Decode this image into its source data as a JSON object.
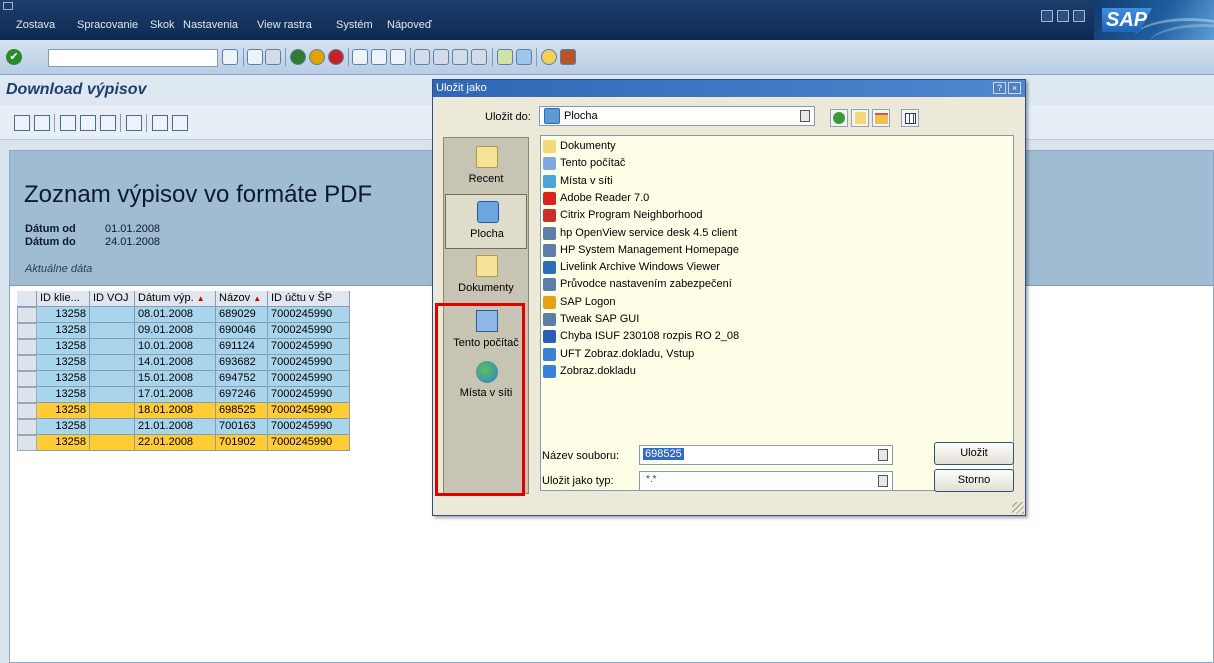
{
  "window": {
    "menu": [
      "Zostava",
      "Spracovanie",
      "Skok",
      "Nastavenia",
      "View rastra",
      "Systém",
      "Nápoveď"
    ],
    "logo_text": "SAP"
  },
  "screen": {
    "title": "Download výpisov"
  },
  "report": {
    "title": "Zoznam výpisov vo formáte PDF",
    "date_from_label": "Dátum od",
    "date_from": "01.01.2008",
    "date_to_label": "Dátum do",
    "date_to": "24.01.2008",
    "note": "Aktuálne dáta"
  },
  "grid": {
    "columns": [
      "ID klie...",
      "ID VOJ",
      "Dátum výp.",
      "Názov",
      "ID účtu v ŠP"
    ],
    "rows": [
      {
        "id": "13258",
        "voj": "",
        "date": "08.01.2008",
        "name": "689029",
        "account": "7000245990",
        "highlight": false
      },
      {
        "id": "13258",
        "voj": "",
        "date": "09.01.2008",
        "name": "690046",
        "account": "7000245990",
        "highlight": false
      },
      {
        "id": "13258",
        "voj": "",
        "date": "10.01.2008",
        "name": "691124",
        "account": "7000245990",
        "highlight": false
      },
      {
        "id": "13258",
        "voj": "",
        "date": "14.01.2008",
        "name": "693682",
        "account": "7000245990",
        "highlight": false
      },
      {
        "id": "13258",
        "voj": "",
        "date": "15.01.2008",
        "name": "694752",
        "account": "7000245990",
        "highlight": false
      },
      {
        "id": "13258",
        "voj": "",
        "date": "17.01.2008",
        "name": "697246",
        "account": "7000245990",
        "highlight": false
      },
      {
        "id": "13258",
        "voj": "",
        "date": "18.01.2008",
        "name": "698525",
        "account": "7000245990",
        "highlight": true
      },
      {
        "id": "13258",
        "voj": "",
        "date": "21.01.2008",
        "name": "700163",
        "account": "7000245990",
        "highlight": false
      },
      {
        "id": "13258",
        "voj": "",
        "date": "22.01.2008",
        "name": "701902",
        "account": "7000245990",
        "highlight": true
      }
    ]
  },
  "dialog": {
    "title": "Uložit jako",
    "save_in_label": "Uložit do:",
    "save_in_value": "Plocha",
    "places": [
      "Recent",
      "Plocha",
      "Dokumenty",
      "Tento počítač",
      "Místa v síti"
    ],
    "files": [
      {
        "name": "Dokumenty",
        "icon": "folder-icon"
      },
      {
        "name": "Tento počítač",
        "icon": "computer-icon"
      },
      {
        "name": "Místa v síti",
        "icon": "network-icon"
      },
      {
        "name": "Adobe Reader 7.0",
        "icon": "adobe-icon"
      },
      {
        "name": "Citrix Program Neighborhood",
        "icon": "citrix-icon"
      },
      {
        "name": "hp OpenView service desk 4.5 client",
        "icon": "shortcut-icon"
      },
      {
        "name": "HP System Management Homepage",
        "icon": "shortcut-icon"
      },
      {
        "name": "Livelink Archive Windows Viewer",
        "icon": "livelink-icon"
      },
      {
        "name": "Průvodce nastavením zabezpečení",
        "icon": "shortcut-icon"
      },
      {
        "name": "SAP Logon",
        "icon": "sap-logon-icon"
      },
      {
        "name": "Tweak SAP GUI",
        "icon": "shortcut-icon"
      },
      {
        "name": "Chyba ISUF 230108 rozpis RO 2_08",
        "icon": "word-icon"
      },
      {
        "name": "UFT Zobraz.dokladu, Vstup",
        "icon": "sap-shortcut-icon"
      },
      {
        "name": "Zobraz.dokladu",
        "icon": "sap-shortcut-icon"
      }
    ],
    "filename_label": "Název souboru:",
    "filename_value": "698525",
    "filetype_label": "Uložit jako typ:",
    "filetype_value": "*.*",
    "save_button": "Uložit",
    "cancel_button": "Storno"
  },
  "colors": {
    "menubar": "#1c3e6b",
    "grid_blue": "#a9d5ec",
    "grid_yellow": "#ffcc33",
    "highlight_box": "#e00000"
  }
}
